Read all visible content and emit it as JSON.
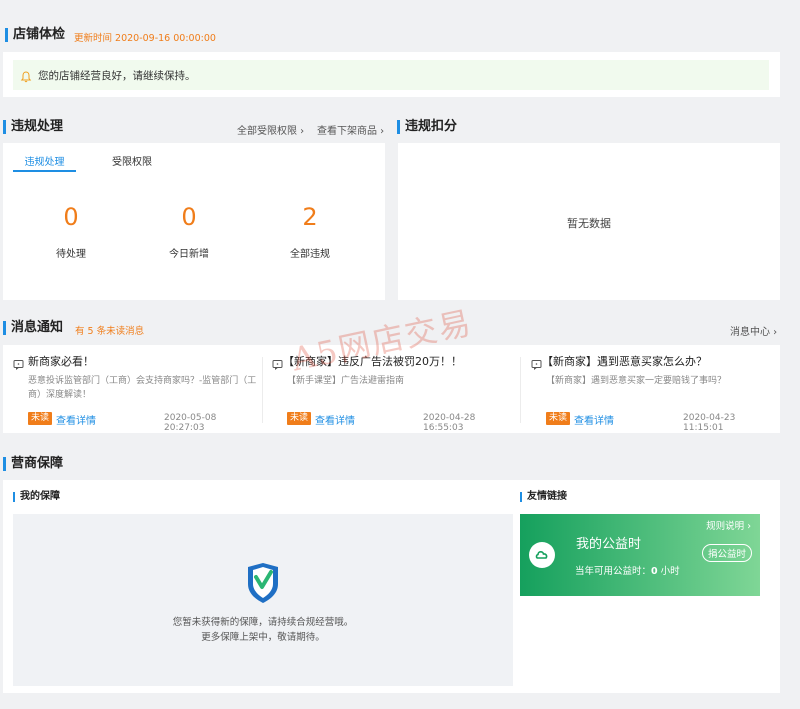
{
  "colors": {
    "accent": "#1e8ee3",
    "orange": "#f07d1a",
    "notice_bg": "#f1faee",
    "card_green_start": "#15a05d",
    "card_green_end": "#7fd696"
  },
  "checkup": {
    "title": "店铺体检",
    "update_time": "更新时间 2020-09-16 00:00:00",
    "notice_icon": "bell-icon",
    "notice_text": "您的店铺经营良好，请继续保持。"
  },
  "violation": {
    "title": "违规处理",
    "link_all_restrictions": "全部受限权限 ›",
    "link_removed_goods": "查看下架商品 ›",
    "tabs": [
      {
        "label": "违规处理",
        "active": true
      },
      {
        "label": "受限权限",
        "active": false
      }
    ],
    "stats": [
      {
        "value": "0",
        "label": "待处理"
      },
      {
        "value": "0",
        "label": "今日新增"
      },
      {
        "value": "2",
        "label": "全部违规"
      }
    ]
  },
  "deduction": {
    "title": "违规扣分",
    "empty_text": "暂无数据"
  },
  "messages": {
    "title": "消息通知",
    "unread_hint": "有 5 条未读消息",
    "center_link": "消息中心 ›",
    "items": [
      {
        "title": "新商家必看！",
        "desc": "恶意投诉监管部门（工商）会支持商家吗？-监管部门（工商）深度解读！",
        "badge": "未读",
        "action": "查看详情",
        "time": "2020-05-08 20:27:03"
      },
      {
        "title": "【新商家】违反广告法被罚20万！！",
        "desc": "【新手课堂】广告法避雷指南",
        "badge": "未读",
        "action": "查看详情",
        "time": "2020-04-28 16:55:03"
      },
      {
        "title": "【新商家】遇到恶意买家怎么办？",
        "desc": "【新商家】遇到恶意买家一定要赔钱了事吗？",
        "badge": "未读",
        "action": "查看详情",
        "time": "2020-04-23 11:15:01"
      }
    ]
  },
  "guarantee": {
    "title": "营商保障",
    "my_guarantee": {
      "title": "我的保障",
      "empty_line1": "您暂未获得新的保障，请持续合规经营哦。",
      "empty_line2": "更多保障上架中，敬请期待。"
    },
    "links": {
      "title": "友情链接",
      "card_title": "我的公益时",
      "rules_link": "规则说明 ›",
      "donate_button": "捐公益时",
      "available_label": "当年可用公益时：",
      "available_value": "0",
      "available_unit": "小时"
    }
  },
  "watermark": "A5网店交易"
}
